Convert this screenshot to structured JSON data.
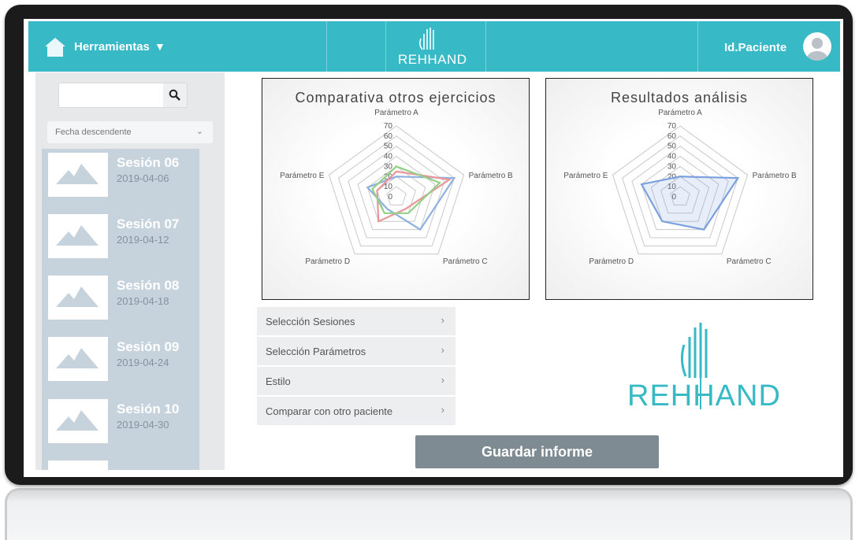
{
  "header": {
    "tools_label": "Herramientas",
    "logo_text": "REHHAND",
    "patient_label": "Id.Paciente"
  },
  "sidebar": {
    "search": {
      "value": "",
      "placeholder": ""
    },
    "sort": {
      "selected": "Fecha descendente"
    },
    "sessions": [
      {
        "name": "Sesión 06",
        "date": "2019-04-06"
      },
      {
        "name": "Sesión 07",
        "date": "2019-04-12"
      },
      {
        "name": "Sesión 08",
        "date": "2019-04-18"
      },
      {
        "name": "Sesión 09",
        "date": "2019-04-24"
      },
      {
        "name": "Sesión 10",
        "date": "2019-04-30"
      }
    ]
  },
  "chart_data": [
    {
      "type": "radar",
      "title": "Comparativa otros ejercicios",
      "categories": [
        "Parámetro A",
        "Parámetro B",
        "Parámetro C",
        "Parámetro D",
        "Parámetro E"
      ],
      "rlim": [
        0,
        70
      ],
      "ticks": [
        0,
        10,
        20,
        30,
        40,
        50,
        60,
        70
      ],
      "grid": true,
      "series": [
        {
          "values": [
            20,
            60,
            40,
            15,
            30
          ],
          "color": "#8fb1e0"
        },
        {
          "values": [
            25,
            55,
            15,
            30,
            20
          ],
          "color": "#e9969a"
        },
        {
          "values": [
            30,
            45,
            20,
            20,
            25
          ],
          "color": "#93d187"
        }
      ]
    },
    {
      "type": "radar",
      "title": "Resultados análisis",
      "categories": [
        "Parámetro A",
        "Parámetro B",
        "Parámetro C",
        "Parámetro D",
        "Parámetro E"
      ],
      "rlim": [
        0,
        70
      ],
      "ticks": [
        0,
        10,
        20,
        30,
        40,
        50,
        60,
        70
      ],
      "grid": true,
      "series": [
        {
          "values": [
            20,
            60,
            40,
            30,
            40
          ],
          "color": "#7aa0dd"
        }
      ]
    }
  ],
  "menu": {
    "items": [
      {
        "label": "Selección Sesiones"
      },
      {
        "label": "Selección Parámetros"
      },
      {
        "label": "Estilo"
      },
      {
        "label": "Comparar con otro paciente"
      }
    ]
  },
  "brand": {
    "logo_text": "REHHAND",
    "color": "#37b9c6"
  },
  "actions": {
    "save_label": "Guardar informe"
  }
}
